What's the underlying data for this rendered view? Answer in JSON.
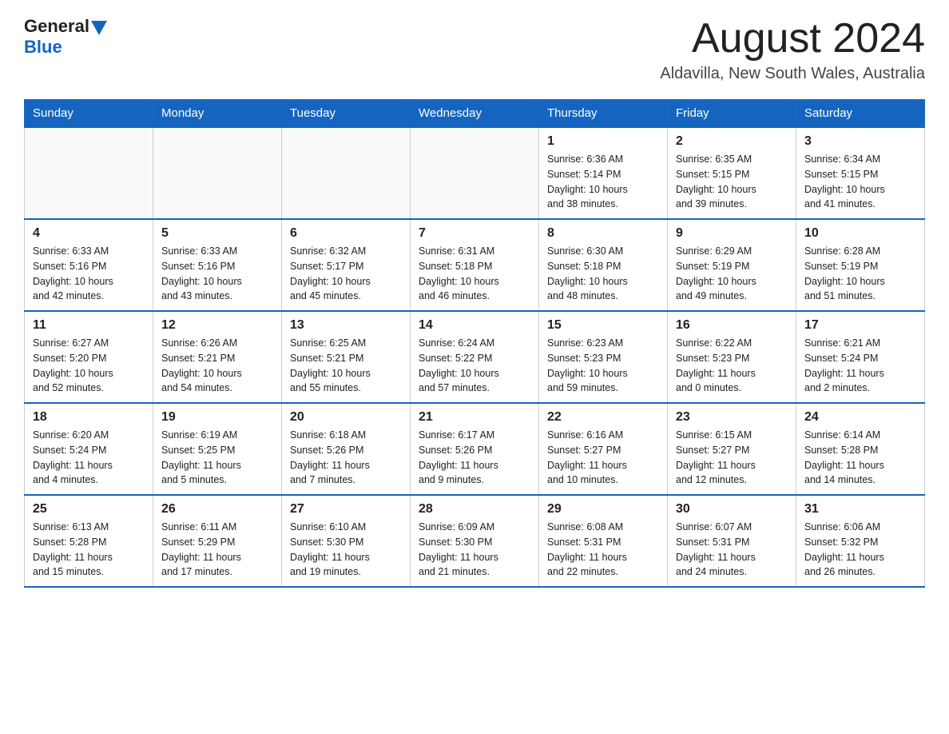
{
  "header": {
    "logo_general": "General",
    "logo_blue": "Blue",
    "month_title": "August 2024",
    "location": "Aldavilla, New South Wales, Australia"
  },
  "weekdays": [
    "Sunday",
    "Monday",
    "Tuesday",
    "Wednesday",
    "Thursday",
    "Friday",
    "Saturday"
  ],
  "weeks": [
    [
      {
        "day": "",
        "info": ""
      },
      {
        "day": "",
        "info": ""
      },
      {
        "day": "",
        "info": ""
      },
      {
        "day": "",
        "info": ""
      },
      {
        "day": "1",
        "info": "Sunrise: 6:36 AM\nSunset: 5:14 PM\nDaylight: 10 hours\nand 38 minutes."
      },
      {
        "day": "2",
        "info": "Sunrise: 6:35 AM\nSunset: 5:15 PM\nDaylight: 10 hours\nand 39 minutes."
      },
      {
        "day": "3",
        "info": "Sunrise: 6:34 AM\nSunset: 5:15 PM\nDaylight: 10 hours\nand 41 minutes."
      }
    ],
    [
      {
        "day": "4",
        "info": "Sunrise: 6:33 AM\nSunset: 5:16 PM\nDaylight: 10 hours\nand 42 minutes."
      },
      {
        "day": "5",
        "info": "Sunrise: 6:33 AM\nSunset: 5:16 PM\nDaylight: 10 hours\nand 43 minutes."
      },
      {
        "day": "6",
        "info": "Sunrise: 6:32 AM\nSunset: 5:17 PM\nDaylight: 10 hours\nand 45 minutes."
      },
      {
        "day": "7",
        "info": "Sunrise: 6:31 AM\nSunset: 5:18 PM\nDaylight: 10 hours\nand 46 minutes."
      },
      {
        "day": "8",
        "info": "Sunrise: 6:30 AM\nSunset: 5:18 PM\nDaylight: 10 hours\nand 48 minutes."
      },
      {
        "day": "9",
        "info": "Sunrise: 6:29 AM\nSunset: 5:19 PM\nDaylight: 10 hours\nand 49 minutes."
      },
      {
        "day": "10",
        "info": "Sunrise: 6:28 AM\nSunset: 5:19 PM\nDaylight: 10 hours\nand 51 minutes."
      }
    ],
    [
      {
        "day": "11",
        "info": "Sunrise: 6:27 AM\nSunset: 5:20 PM\nDaylight: 10 hours\nand 52 minutes."
      },
      {
        "day": "12",
        "info": "Sunrise: 6:26 AM\nSunset: 5:21 PM\nDaylight: 10 hours\nand 54 minutes."
      },
      {
        "day": "13",
        "info": "Sunrise: 6:25 AM\nSunset: 5:21 PM\nDaylight: 10 hours\nand 55 minutes."
      },
      {
        "day": "14",
        "info": "Sunrise: 6:24 AM\nSunset: 5:22 PM\nDaylight: 10 hours\nand 57 minutes."
      },
      {
        "day": "15",
        "info": "Sunrise: 6:23 AM\nSunset: 5:23 PM\nDaylight: 10 hours\nand 59 minutes."
      },
      {
        "day": "16",
        "info": "Sunrise: 6:22 AM\nSunset: 5:23 PM\nDaylight: 11 hours\nand 0 minutes."
      },
      {
        "day": "17",
        "info": "Sunrise: 6:21 AM\nSunset: 5:24 PM\nDaylight: 11 hours\nand 2 minutes."
      }
    ],
    [
      {
        "day": "18",
        "info": "Sunrise: 6:20 AM\nSunset: 5:24 PM\nDaylight: 11 hours\nand 4 minutes."
      },
      {
        "day": "19",
        "info": "Sunrise: 6:19 AM\nSunset: 5:25 PM\nDaylight: 11 hours\nand 5 minutes."
      },
      {
        "day": "20",
        "info": "Sunrise: 6:18 AM\nSunset: 5:26 PM\nDaylight: 11 hours\nand 7 minutes."
      },
      {
        "day": "21",
        "info": "Sunrise: 6:17 AM\nSunset: 5:26 PM\nDaylight: 11 hours\nand 9 minutes."
      },
      {
        "day": "22",
        "info": "Sunrise: 6:16 AM\nSunset: 5:27 PM\nDaylight: 11 hours\nand 10 minutes."
      },
      {
        "day": "23",
        "info": "Sunrise: 6:15 AM\nSunset: 5:27 PM\nDaylight: 11 hours\nand 12 minutes."
      },
      {
        "day": "24",
        "info": "Sunrise: 6:14 AM\nSunset: 5:28 PM\nDaylight: 11 hours\nand 14 minutes."
      }
    ],
    [
      {
        "day": "25",
        "info": "Sunrise: 6:13 AM\nSunset: 5:28 PM\nDaylight: 11 hours\nand 15 minutes."
      },
      {
        "day": "26",
        "info": "Sunrise: 6:11 AM\nSunset: 5:29 PM\nDaylight: 11 hours\nand 17 minutes."
      },
      {
        "day": "27",
        "info": "Sunrise: 6:10 AM\nSunset: 5:30 PM\nDaylight: 11 hours\nand 19 minutes."
      },
      {
        "day": "28",
        "info": "Sunrise: 6:09 AM\nSunset: 5:30 PM\nDaylight: 11 hours\nand 21 minutes."
      },
      {
        "day": "29",
        "info": "Sunrise: 6:08 AM\nSunset: 5:31 PM\nDaylight: 11 hours\nand 22 minutes."
      },
      {
        "day": "30",
        "info": "Sunrise: 6:07 AM\nSunset: 5:31 PM\nDaylight: 11 hours\nand 24 minutes."
      },
      {
        "day": "31",
        "info": "Sunrise: 6:06 AM\nSunset: 5:32 PM\nDaylight: 11 hours\nand 26 minutes."
      }
    ]
  ]
}
